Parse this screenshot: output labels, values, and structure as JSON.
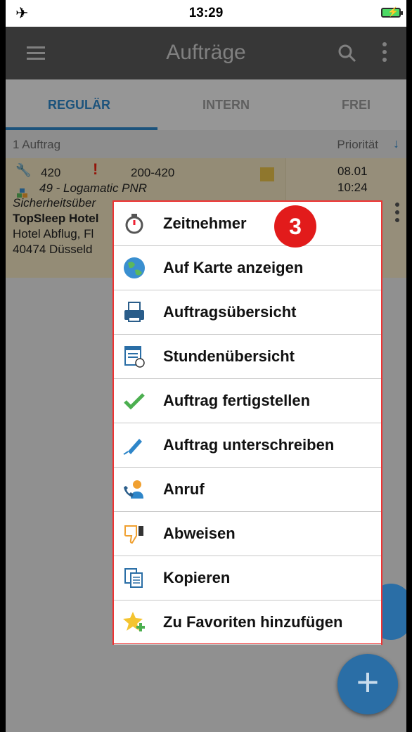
{
  "status_bar": {
    "time": "13:29"
  },
  "app_bar": {
    "title": "Aufträge"
  },
  "tabs": [
    {
      "label": "REGULÄR",
      "active": true
    },
    {
      "label": "INTERN",
      "active": false
    },
    {
      "label": "FREI",
      "active": false
    }
  ],
  "list_header": {
    "count": "1 Auftrag",
    "sort_label": "Priorität",
    "sort_arrow": "↓"
  },
  "order": {
    "number": "420",
    "priority_mark": "!",
    "code": "200-420",
    "date": "08.01",
    "time": "10:24",
    "project": "49 - Logamatic PNR",
    "description": "Sicherheitsüber",
    "customer": "TopSleep Hotel",
    "address1": "Hotel Abflug, Fl",
    "address2": "40474 Düsseld"
  },
  "context_menu": {
    "badge": "3",
    "items": [
      {
        "label": "Zeitnehmer",
        "icon": "stopwatch-icon"
      },
      {
        "label": "Auf Karte anzeigen",
        "icon": "globe-icon"
      },
      {
        "label": "Auftragsübersicht",
        "icon": "printer-icon"
      },
      {
        "label": "Stundenübersicht",
        "icon": "timesheet-icon"
      },
      {
        "label": "Auftrag fertigstellen",
        "icon": "checkmark-icon"
      },
      {
        "label": "Auftrag unterschreiben",
        "icon": "pen-icon"
      },
      {
        "label": "Anruf",
        "icon": "phone-contact-icon"
      },
      {
        "label": "Abweisen",
        "icon": "thumbs-down-icon"
      },
      {
        "label": "Kopieren",
        "icon": "copy-icon"
      },
      {
        "label": "Zu Favoriten hinzufügen",
        "icon": "star-add-icon"
      }
    ]
  },
  "fab": {
    "label": "+"
  },
  "colors": {
    "accent": "#2e86c9",
    "appbar": "#5a5a5a",
    "card": "#efe2bf",
    "highlight": "#e33333"
  }
}
